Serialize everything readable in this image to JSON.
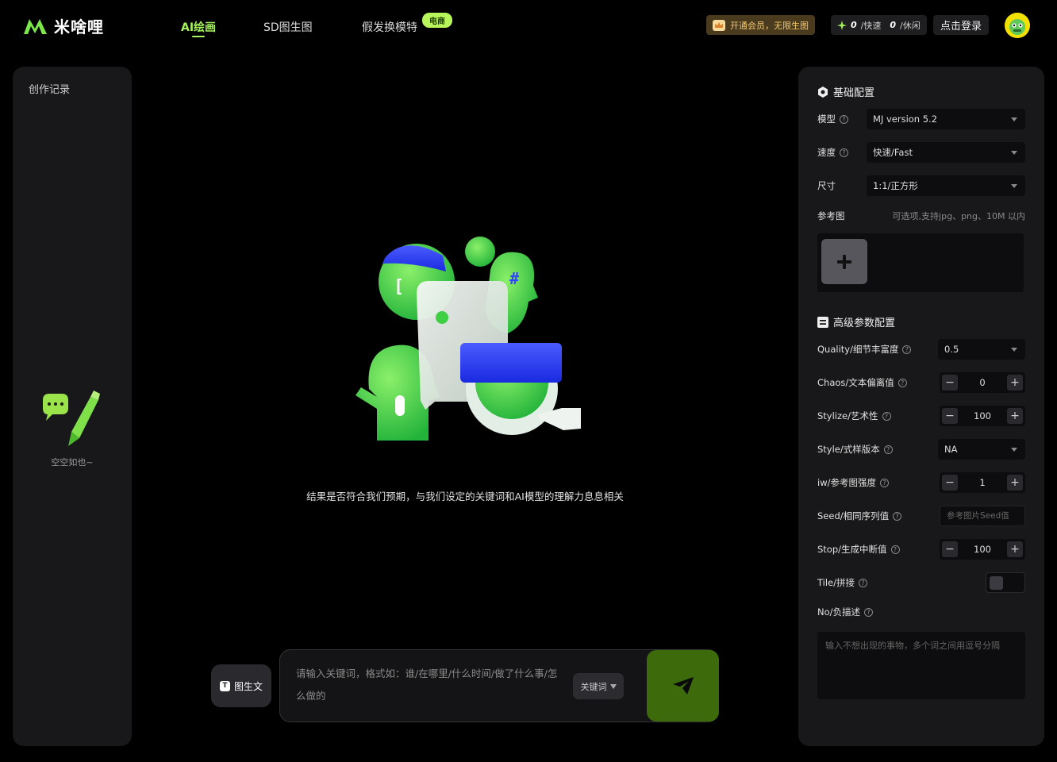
{
  "header": {
    "logo_text": "米啥哩",
    "nav": [
      {
        "label": "AI绘画",
        "active": true
      },
      {
        "label": "SD图生图",
        "active": false
      },
      {
        "label": "假发换模特",
        "active": false,
        "badge": "电商"
      }
    ],
    "vip_label": "开通会员，无限生图",
    "quota": {
      "fast_count": "0",
      "fast_label": "/快速",
      "relax_count": "0",
      "relax_label": "/休闲"
    },
    "login_label": "点击登录"
  },
  "left_panel": {
    "title": "创作记录",
    "empty_text": "空空如也~"
  },
  "center": {
    "hint": "结果是否符合我们预期，与我们设定的关键词和AI模型的理解力息息相关",
    "t2t_label": "图生文",
    "prompt_placeholder": "请输入关键词，格式如：谁/在哪里/什么时间/做了什么事/怎么做的",
    "keyword_select": "关键词"
  },
  "right_panel": {
    "basic_title": "基础配置",
    "model": {
      "label": "模型",
      "value": "MJ version 5.2"
    },
    "speed": {
      "label": "速度",
      "value": "快速/Fast"
    },
    "size": {
      "label": "尺寸",
      "value": "1:1/正方形"
    },
    "reference": {
      "label": "参考图",
      "hint": "可选项,支持jpg、png、10M 以内"
    },
    "advanced_title": "高级参数配置",
    "quality": {
      "label": "Quality/细节丰富度",
      "value": "0.5"
    },
    "chaos": {
      "label": "Chaos/文本偏离值",
      "value": "0"
    },
    "stylize": {
      "label": "Stylize/艺术性",
      "value": "100"
    },
    "style": {
      "label": "Style/式样版本",
      "value": "NA"
    },
    "iw": {
      "label": "iw/参考图强度",
      "value": "1"
    },
    "seed": {
      "label": "Seed/相同序列值",
      "placeholder": "参考图片Seed值"
    },
    "stop": {
      "label": "Stop/生成中断值",
      "value": "100"
    },
    "tile": {
      "label": "Tile/拼接"
    },
    "no": {
      "label": "No/负描述",
      "placeholder": "输入不想出现的事物，多个词之间用逗号分隔"
    }
  },
  "colors": {
    "accent": "#a6f35c",
    "send": "#3d6a0a",
    "panel": "#18181b"
  }
}
